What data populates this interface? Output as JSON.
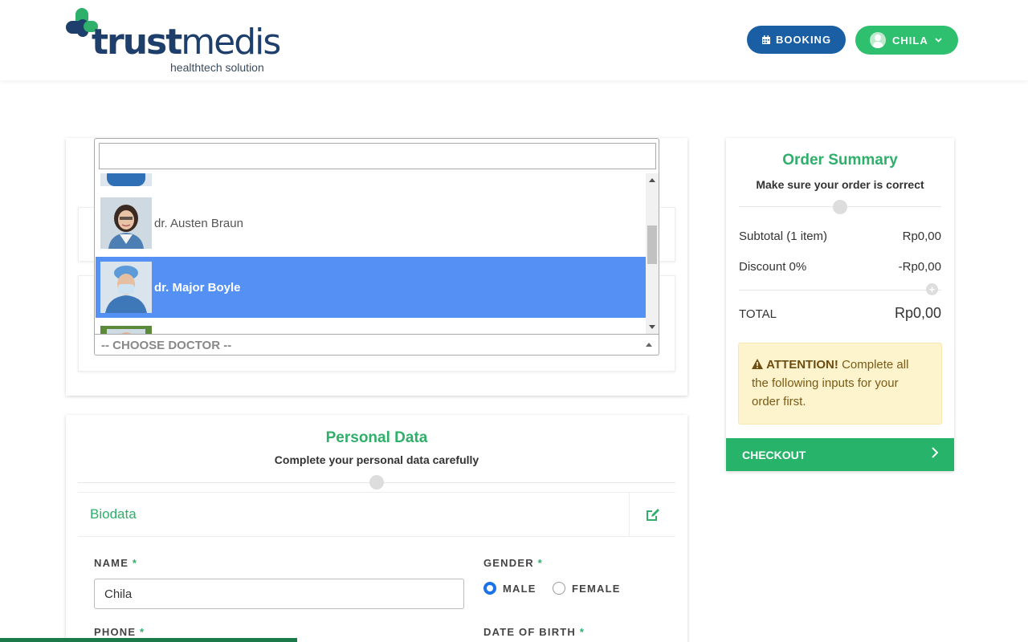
{
  "header": {
    "logo_main_1": "trust",
    "logo_main_2": "medis",
    "logo_sub": "healthtech solution",
    "booking_label": "BOOKING",
    "user_label": "CHILA"
  },
  "doctor_select": {
    "search_value": "",
    "items": [
      {
        "name": ""
      },
      {
        "name": "dr. Austen Braun"
      },
      {
        "name": "dr. Major Boyle"
      },
      {
        "name": ""
      }
    ],
    "selected_index": 2,
    "placeholder": "-- CHOOSE DOCTOR --",
    "scroll_position": 0.33
  },
  "personal": {
    "title": "Personal Data",
    "subtitle": "Complete your personal data carefully",
    "biodata_label": "Biodata",
    "name_label": "NAME",
    "name_value": "Chila",
    "gender_label": "GENDER",
    "gender_options": [
      "MALE",
      "FEMALE"
    ],
    "gender_selected": "MALE",
    "phone_label": "PHONE",
    "dob_label": "DATE OF BIRTH",
    "required_mark": "*"
  },
  "summary": {
    "title": "Order Summary",
    "subtitle": "Make sure your order is correct",
    "subtotal_label": "Subtotal (1 item)",
    "subtotal_value": "Rp0,00",
    "discount_label": "Discount 0%",
    "discount_value": "-Rp0,00",
    "total_label": "TOTAL",
    "total_value": "Rp0,00",
    "attention_title": "ATTENTION!",
    "attention_text": "Complete all the following inputs for your order first.",
    "checkout_label": "CHECKOUT"
  },
  "colors": {
    "brand_green": "#2eaf6a",
    "brand_blue": "#1a5fa3",
    "selection_blue": "#5591f5",
    "attention_bg": "#fdf3cd"
  },
  "page_progress": 0.29
}
